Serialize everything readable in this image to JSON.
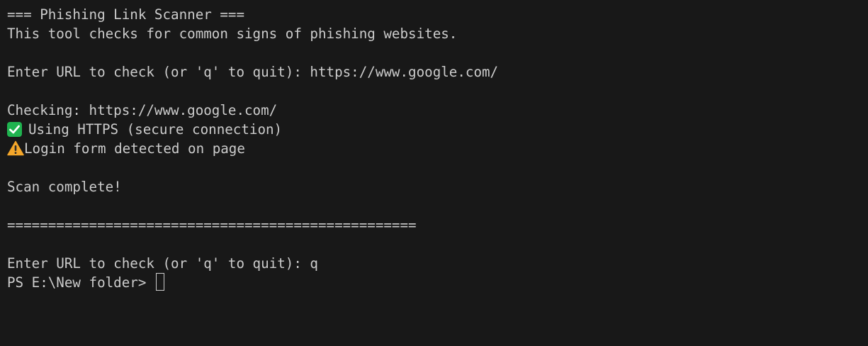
{
  "terminal": {
    "lines": {
      "banner": "=== Phishing Link Scanner ===",
      "description": "This tool checks for common signs of phishing websites.",
      "prompt1": "Enter URL to check (or 'q' to quit): https://www.google.com/",
      "checking": "Checking: https://www.google.com/",
      "https_result": "Using HTTPS (secure connection)",
      "login_warning": "Login form detected on page",
      "scan_complete": "Scan complete!",
      "separator": "==================================================",
      "prompt2": "Enter URL to check (or 'q' to quit): q",
      "ps_prompt": "PS E:\\New folder> "
    },
    "icons": {
      "https_result": "check-mark-button-icon",
      "login_warning": "warning-icon"
    },
    "colors": {
      "background": "#181818",
      "text": "#cccccc",
      "check_green": "#1fb34f",
      "warning_orange": "#f4a62a"
    }
  }
}
